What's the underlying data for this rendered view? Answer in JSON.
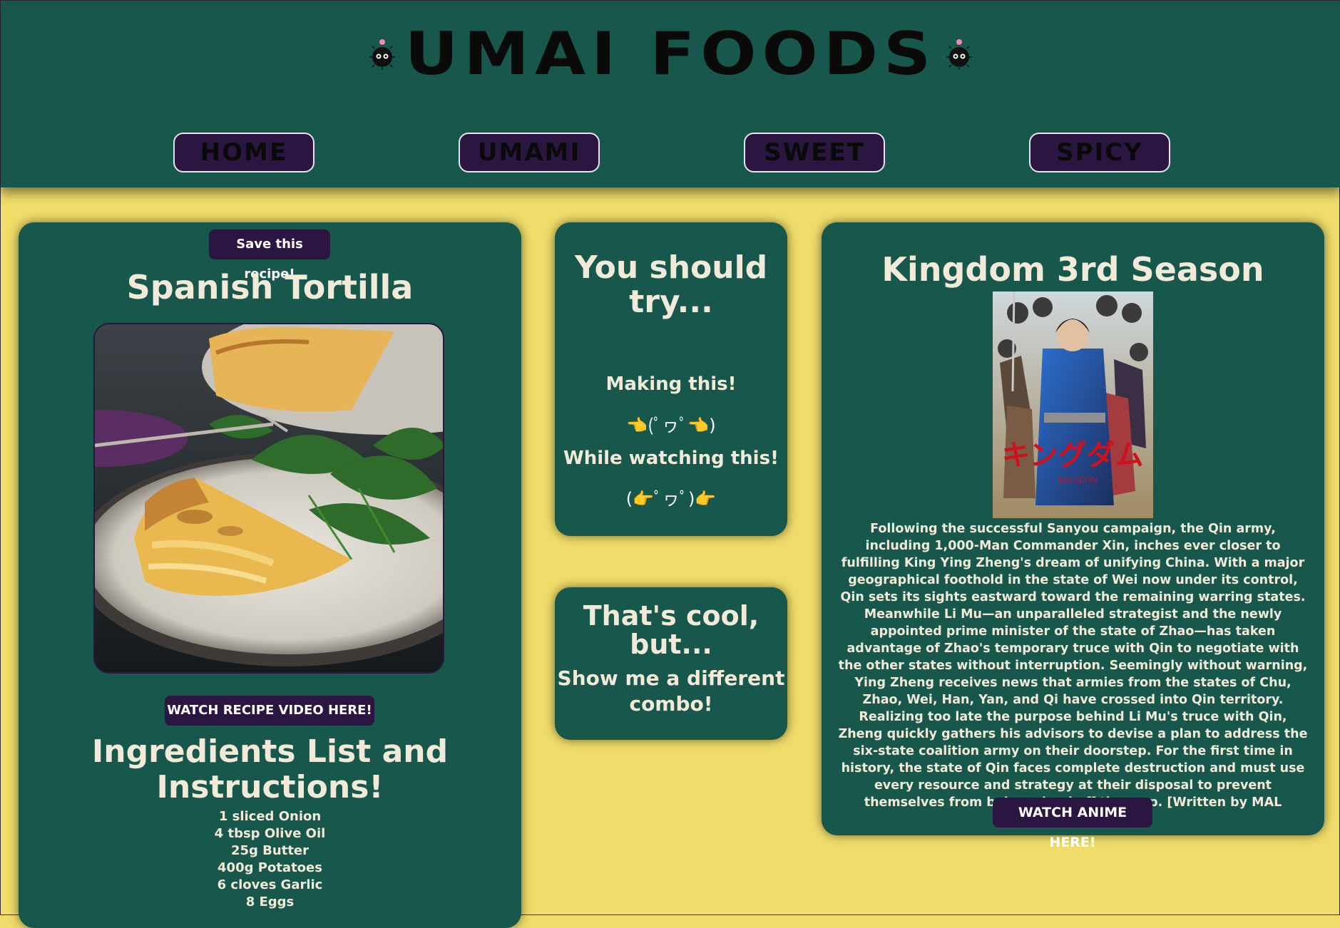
{
  "site": {
    "title": "UMAI FOODS"
  },
  "nav": {
    "items": [
      "HOME",
      "UMAMI",
      "SWEET",
      "SPICY"
    ]
  },
  "recipe": {
    "save_label": "Save this recipe!",
    "title": "Spanish Tortilla",
    "video_label": "WATCH RECIPE VIDEO HERE!",
    "ingredients_title": "Ingredients List and Instructions!",
    "ingredients": [
      "1 sliced Onion",
      "4 tbsp Olive Oil",
      "25g Butter",
      "400g Potatoes",
      "6 cloves Garlic",
      "8 Eggs"
    ]
  },
  "suggestion": {
    "title": "You should try...",
    "making": "Making this!",
    "kaomoji_1": "👈(ﾟヮﾟ👈)",
    "watching": "While watching this!",
    "kaomoji_2": "(👉ﾟヮﾟ)👉"
  },
  "shuffle": {
    "title": "That's cool, but...",
    "link": "Show me a different combo!"
  },
  "anime": {
    "title": "Kingdom 3rd Season",
    "poster_text": "キングダム",
    "poster_subtext": "KINGDOM",
    "synopsis": "Following the successful Sanyou campaign, the Qin army, including 1,000-Man Commander Xin, inches ever closer to fulfilling King Ying Zheng's dream of unifying China. With a major geographical foothold in the state of Wei now under its control, Qin sets its sights eastward toward the remaining warring states. Meanwhile Li Mu—an unparalleled strategist and the newly appointed prime minister of the state of Zhao—has taken advantage of Zhao's temporary truce with Qin to negotiate with the other states without interruption. Seemingly without warning, Ying Zheng receives news that armies from the states of Chu, Zhao, Wei, Han, Yan, and Qi have crossed into Qin territory. Realizing too late the purpose behind Li Mu's truce with Qin, Zheng quickly gathers his advisors to devise a plan to address the six-state coalition army on their doorstep. For the first time in history, the state of Qin faces complete destruction and must use every resource and strategy at their disposal to prevent themselves from being wiped off the map. [Written by MAL Rewrite]",
    "watch_label": "WATCH ANIME HERE!"
  },
  "colors": {
    "background": "#efdc6a",
    "panel": "#17574c",
    "button": "#2a1640"
  }
}
